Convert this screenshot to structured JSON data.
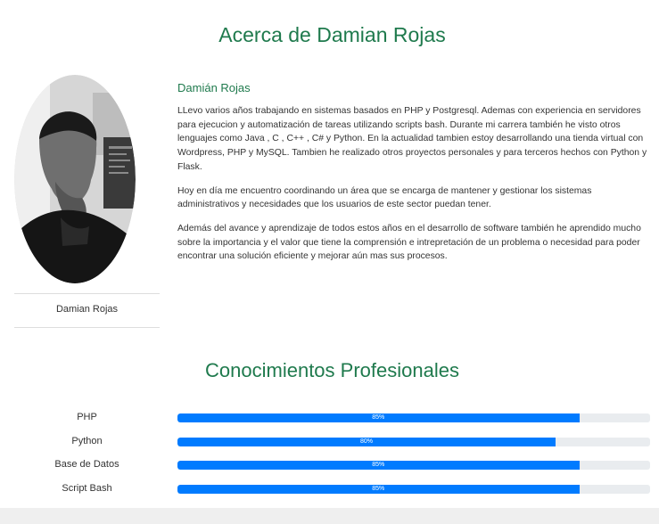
{
  "about": {
    "title": "Acerca de Damian Rojas"
  },
  "profile": {
    "card_name": "Damian Rojas",
    "avatar_icon": "person-photo"
  },
  "bio": {
    "name": "Damián Rojas",
    "paragraphs": [
      "LLevo varios años trabajando en sistemas basados en PHP y Postgresql. Ademas con experiencia en servidores para ejecucion y automatización de tareas utilizando scripts bash. Durante mi carrera también he visto otros lenguajes como Java , C , C++ , C# y Python. En la actualidad tambien estoy desarrollando una tienda virtual con Wordpress, PHP y MySQL. Tambien he realizado otros proyectos personales y para terceros hechos con Python y Flask.",
      "Hoy en día me encuentro coordinando un área que se encarga de mantener y gestionar los sistemas administrativos y necesidades que los usuarios de este sector puedan tener.",
      "Además del avance y aprendizaje de todos estos años en el desarrollo de software también he aprendido mucho sobre la importancia y el valor que tiene la comprensión e intrepretación de un problema o necesidad para poder encontrar una solución eficiente y mejorar aún mas sus procesos."
    ]
  },
  "skills": {
    "title": "Conocimientos Profesionales",
    "items": [
      {
        "label": "PHP",
        "percent": 85,
        "percent_text": "85%"
      },
      {
        "label": "Python",
        "percent": 80,
        "percent_text": "80%"
      },
      {
        "label": "Base de Datos",
        "percent": 85,
        "percent_text": "85%"
      },
      {
        "label": "Script Bash",
        "percent": 85,
        "percent_text": "85%"
      }
    ]
  },
  "colors": {
    "heading": "#1f7a4d",
    "progress_fill": "#007bff",
    "progress_track": "#e9ecef"
  }
}
